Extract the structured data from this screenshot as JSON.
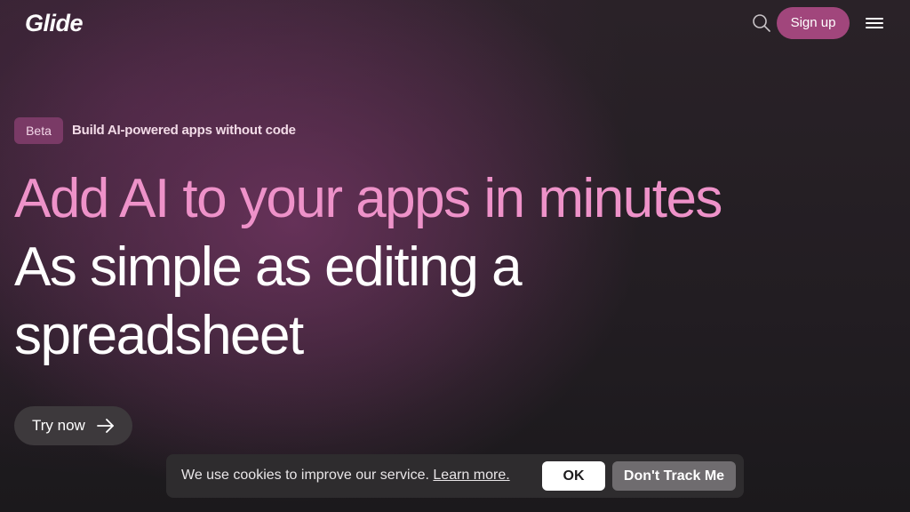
{
  "header": {
    "logo_text": "Glide",
    "search_icon": "search-icon",
    "signup_label": "Sign up",
    "menu_icon": "hamburger-menu-icon"
  },
  "hero": {
    "badge": "Beta",
    "tagline": "Build AI-powered apps without code",
    "headline_accent": "Add AI to your apps in minutes",
    "headline_main": "As simple as editing a spreadsheet",
    "cta_label": "Try now",
    "cta_icon": "arrow-right-icon"
  },
  "cookie_banner": {
    "message": "We use cookies to improve our service.",
    "learn_more": "Learn more.",
    "ok_label": "OK",
    "dont_track_label": "Don't Track Me"
  },
  "colors": {
    "accent_pink": "#ee92c9",
    "signup_button": "#a1467c",
    "badge_background": "#7a3a66",
    "background_dark": "#1f1c1f"
  }
}
